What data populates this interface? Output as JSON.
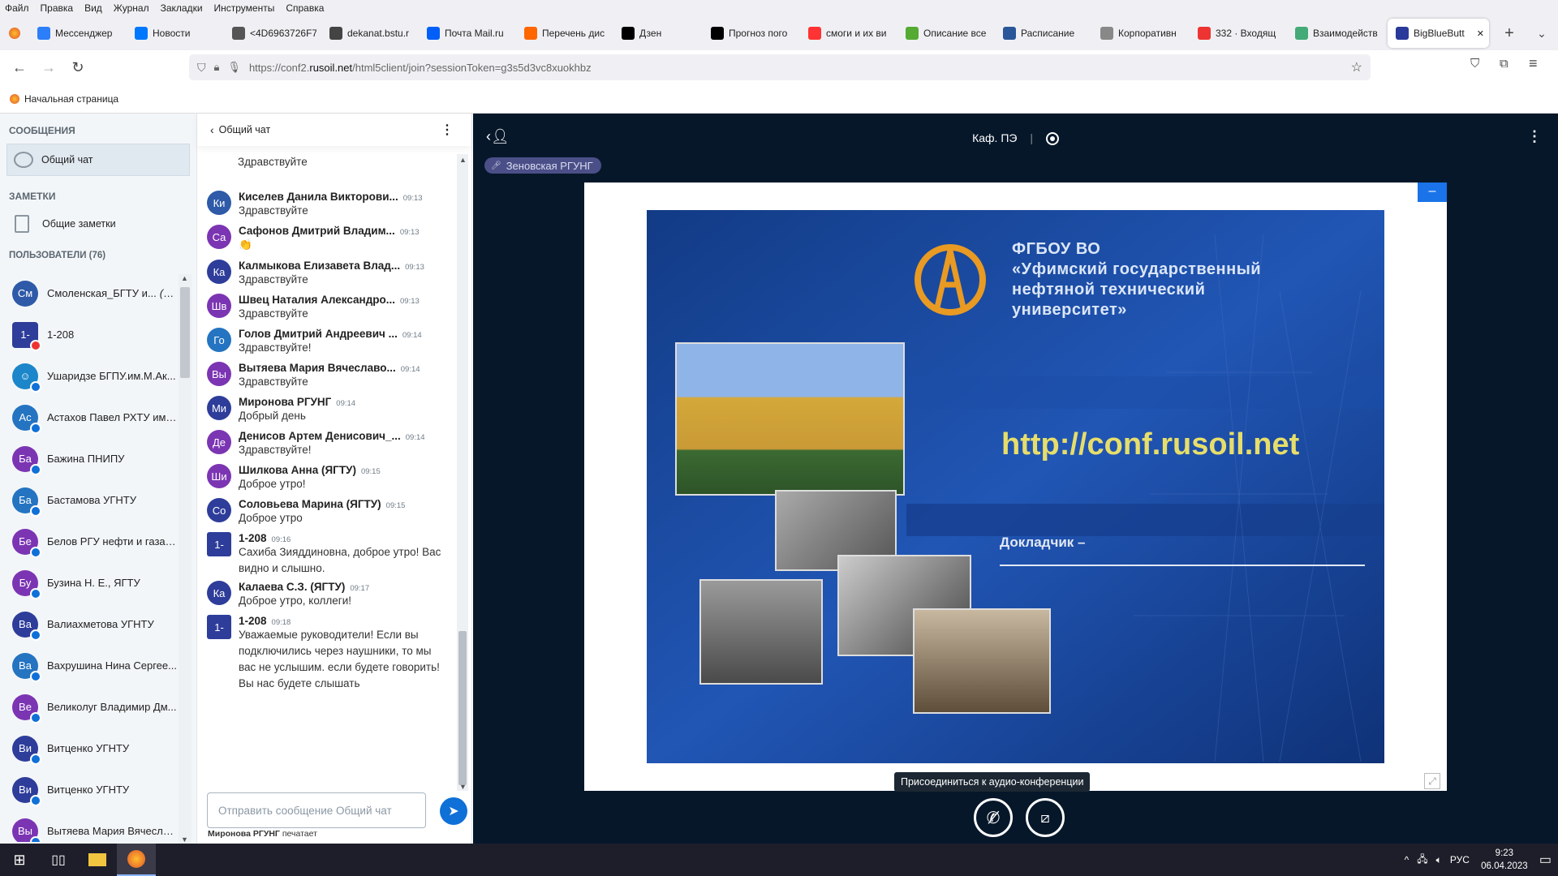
{
  "menu": [
    "Файл",
    "Правка",
    "Вид",
    "Журнал",
    "Закладки",
    "Инструменты",
    "Справка"
  ],
  "tabs": [
    {
      "label": "Мессенджер",
      "color": "#2d7ff9"
    },
    {
      "label": "Новости",
      "color": "#0077ff"
    },
    {
      "label": "<4D6963726F7",
      "color": "#555"
    },
    {
      "label": "dekanat.bstu.r",
      "color": "#444"
    },
    {
      "label": "Почта Mail.ru",
      "color": "#005ff9"
    },
    {
      "label": "Перечень дис",
      "color": "#f60"
    },
    {
      "label": "Дзен",
      "color": "#000"
    },
    {
      "label": "Прогноз пого",
      "color": "#000"
    },
    {
      "label": "смоги и их ви",
      "color": "#f33"
    },
    {
      "label": "Описание все",
      "color": "#5a3"
    },
    {
      "label": "Расписание",
      "color": "#2a5599"
    },
    {
      "label": "Корпоративн",
      "color": "#888"
    },
    {
      "label": "332 · Входящ",
      "color": "#e33"
    },
    {
      "label": "Взаимодейств",
      "color": "#4a7"
    },
    {
      "label": "BigBlueButt",
      "color": "#2a3a9a"
    }
  ],
  "url": {
    "prefix": "https://conf2.",
    "domain": "rusoil.net",
    "rest": "/html5client/join?sessionToken=g3s5d3vc8xuokhbz"
  },
  "bookmark": "Начальная страница",
  "sidebar": {
    "messages_title": "СООБЩЕНИЯ",
    "public_chat": "Общий чат",
    "notes_title": "ЗАМЕТКИ",
    "shared_notes": "Общие заметки",
    "users_title": "ПОЛЬЗОВАТЕЛИ (76)",
    "users": [
      {
        "initials": "См",
        "name": "Смоленская_БГТУ и...",
        "suffix": "(Вы)",
        "color": "#2e5aa8",
        "shape": "circle"
      },
      {
        "initials": "1-",
        "name": "1-208",
        "suffix": "",
        "color": "#2e3d9a",
        "shape": "square"
      },
      {
        "initials": "☺",
        "name": "Ушаридзе БГПУ.им.М.Ак...",
        "suffix": "",
        "color": "#1b86c9",
        "shape": "circle"
      },
      {
        "initials": "Ас",
        "name": "Астахов Павел РХТУ им. ...",
        "suffix": "",
        "color": "#2474c1",
        "shape": "circle"
      },
      {
        "initials": "Ба",
        "name": "Бажина ПНИПУ",
        "suffix": "",
        "color": "#7b35b3",
        "shape": "circle"
      },
      {
        "initials": "Ба",
        "name": "Бастамова УГНТУ",
        "suffix": "",
        "color": "#2474c1",
        "shape": "circle"
      },
      {
        "initials": "Бе",
        "name": "Белов РГУ нефти и газа (...",
        "suffix": "",
        "color": "#7b35b3",
        "shape": "circle"
      },
      {
        "initials": "Бу",
        "name": "Бузина Н. Е., ЯГТУ",
        "suffix": "",
        "color": "#7b35b3",
        "shape": "circle"
      },
      {
        "initials": "Ва",
        "name": "Валиахметова УГНТУ",
        "suffix": "",
        "color": "#2e3d9a",
        "shape": "circle"
      },
      {
        "initials": "Ва",
        "name": "Вахрушина Нина Сергее...",
        "suffix": "",
        "color": "#2474c1",
        "shape": "circle"
      },
      {
        "initials": "Ве",
        "name": "Великолуг Владимир Дм...",
        "suffix": "",
        "color": "#7b35b3",
        "shape": "circle"
      },
      {
        "initials": "Ви",
        "name": "Витценко УГНТУ",
        "suffix": "",
        "color": "#2e3d9a",
        "shape": "circle"
      },
      {
        "initials": "Ви",
        "name": "Витценко УГНТУ",
        "suffix": "",
        "color": "#2e3d9a",
        "shape": "circle"
      },
      {
        "initials": "Вы",
        "name": "Вытяева Мария Вячесла...",
        "suffix": "",
        "color": "#7b35b3",
        "shape": "circle"
      }
    ]
  },
  "chat": {
    "title": "Общий чат",
    "top_partial": "Здравствуйте",
    "messages": [
      {
        "initials": "Ки",
        "name": "Киселев Данила Викторови...",
        "time": "09:13",
        "text": "Здравствуйте",
        "color": "#2e5aa8",
        "sq": false
      },
      {
        "initials": "Са",
        "name": "Сафонов Дмитрий Владим...",
        "time": "09:13",
        "text": "👏",
        "color": "#7b35b3",
        "sq": false
      },
      {
        "initials": "Ка",
        "name": "Калмыкова Елизавета Влад...",
        "time": "09:13",
        "text": "Здравствуйте",
        "color": "#2e3d9a",
        "sq": false
      },
      {
        "initials": "Шв",
        "name": "Швец Наталия Александро...",
        "time": "09:13",
        "text": "Здравствуйте",
        "color": "#7b35b3",
        "sq": false
      },
      {
        "initials": "Го",
        "name": "Голов Дмитрий Андреевич ...",
        "time": "09:14",
        "text": "Здравствуйте!",
        "color": "#2474c1",
        "sq": false
      },
      {
        "initials": "Вы",
        "name": "Вытяева Мария Вячеславо...",
        "time": "09:14",
        "text": "Здравствуйте",
        "color": "#7b35b3",
        "sq": false
      },
      {
        "initials": "Ми",
        "name": "Миронова РГУНГ",
        "time": "09:14",
        "text": "Добрый день",
        "color": "#2e3d9a",
        "sq": false
      },
      {
        "initials": "Де",
        "name": "Денисов Артем Денисович_...",
        "time": "09:14",
        "text": "Здравствуйте!",
        "color": "#7b35b3",
        "sq": false
      },
      {
        "initials": "Ши",
        "name": "Шилкова Анна (ЯГТУ)",
        "time": "09:15",
        "text": "Доброе утро!",
        "color": "#7b35b3",
        "sq": false
      },
      {
        "initials": "Со",
        "name": "Соловьева Марина (ЯГТУ)",
        "time": "09:15",
        "text": "Доброе утро",
        "color": "#2e3d9a",
        "sq": false
      },
      {
        "initials": "1-",
        "name": "1-208",
        "time": "09:16",
        "text": "Сахиба Зияддиновна, доброе утро! Вас видно и слышно.",
        "color": "#2e3d9a",
        "sq": true
      },
      {
        "initials": "Ка",
        "name": "Калаева С.З. (ЯГТУ)",
        "time": "09:17",
        "text": "Доброе утро, коллеги!",
        "color": "#2e3d9a",
        "sq": false
      },
      {
        "initials": "1-",
        "name": "1-208",
        "time": "09:18",
        "text": "Уважаемые руководители! Если вы подключились через наушники, то мы вас не услышим. если будете говорить! Вы нас будете слышать",
        "color": "#2e3d9a",
        "sq": true
      }
    ],
    "input_placeholder": "Отправить сообщение Общий чат",
    "typing_name": "Миронова РГУНГ",
    "typing_suffix": "печатает"
  },
  "main": {
    "room_title": "Каф. ПЭ",
    "presenter_tag": "Зеновская РГУНГ",
    "audio_tooltip": "Присоединиться к аудио-конференции"
  },
  "slide": {
    "org_line1": "ФГБОУ ВО",
    "org_line2": "«Уфимский государственный",
    "org_line3": "нефтяной технический",
    "org_line4": "университет»",
    "url": "http://conf.rusoil.net",
    "speaker": "Докладчик –"
  },
  "taskbar": {
    "lang": "РУС",
    "time": "9:23",
    "date": "06.04.2023"
  }
}
